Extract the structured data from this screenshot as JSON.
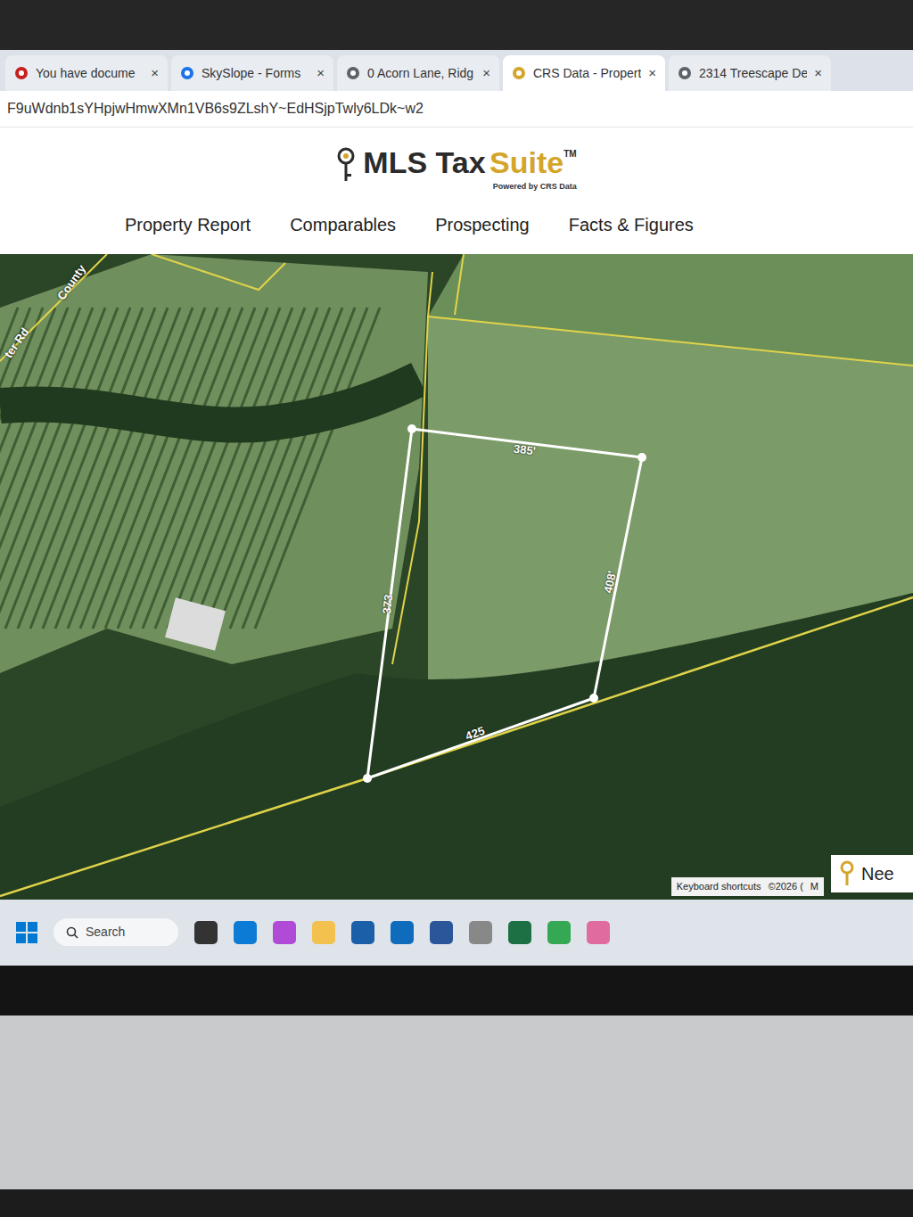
{
  "browser": {
    "tabs": [
      {
        "label": "You have docume",
        "close": "×",
        "selected": false,
        "color": "#c5221f"
      },
      {
        "label": "SkySlope - Forms",
        "close": "×",
        "selected": false,
        "color": "#1a73e8"
      },
      {
        "label": "0 Acorn Lane, Ridg",
        "close": "×",
        "selected": false,
        "color": "#5f6368"
      },
      {
        "label": "CRS Data - Propert",
        "close": "×",
        "selected": true,
        "color": "#d4a52a"
      },
      {
        "label": "2314 Treescape De",
        "close": "×",
        "selected": false,
        "color": "#5f6368"
      }
    ],
    "url": "F9uWdnb1sYHpjwHmwXMn1VB6s9ZLshY~EdHSjpTwly6LDk~w2"
  },
  "app": {
    "logo": {
      "main": "MLS Tax",
      "accent": "Suite",
      "tm": "TM",
      "tagline": "Powered by CRS Data"
    },
    "nav": [
      {
        "label": "Property Report"
      },
      {
        "label": "Comparables"
      },
      {
        "label": "Prospecting"
      },
      {
        "label": "Facts & Figures"
      }
    ]
  },
  "map": {
    "roads": [
      "County",
      "ter Rd"
    ],
    "dimensions": [
      "385'",
      "408'",
      "425",
      "373"
    ],
    "attribution": [
      "Keyboard shortcuts",
      "©2026 (",
      "M"
    ]
  },
  "chat": {
    "label": "Nee"
  },
  "taskbar": {
    "search": "Search"
  }
}
